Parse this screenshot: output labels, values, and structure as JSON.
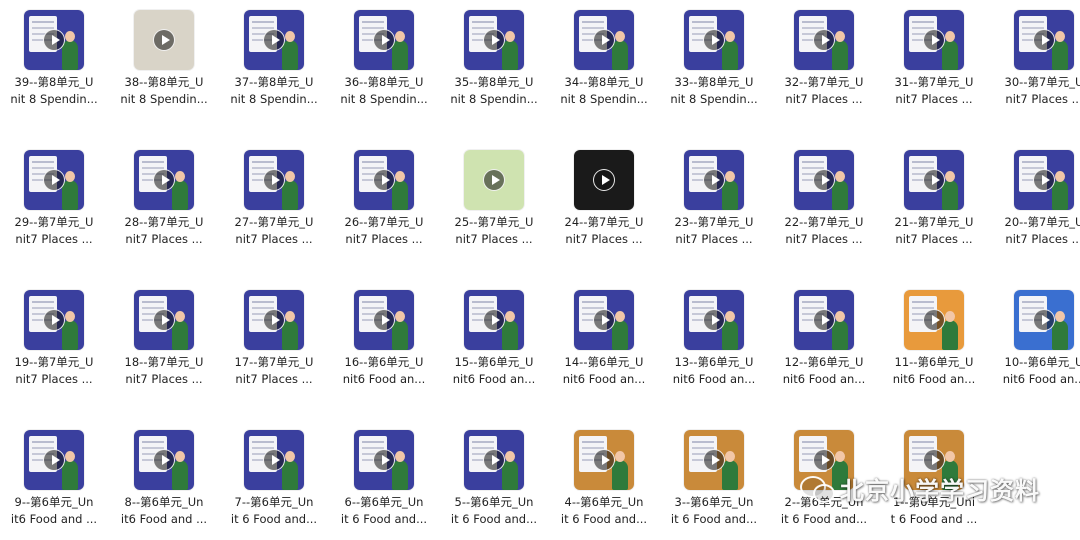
{
  "videos": [
    {
      "line1": "39--第8单元_U",
      "line2": "nit 8 Spendin...",
      "bg": "#3a3f9e"
    },
    {
      "line1": "38--第8单元_U",
      "line2": "nit 8 Spendin...",
      "bg": "#d9d4c8"
    },
    {
      "line1": "37--第8单元_U",
      "line2": "nit 8 Spendin...",
      "bg": "#3a3f9e"
    },
    {
      "line1": "36--第8单元_U",
      "line2": "nit 8 Spendin...",
      "bg": "#3a3f9e"
    },
    {
      "line1": "35--第8单元_U",
      "line2": "nit 8 Spendin...",
      "bg": "#3a3f9e"
    },
    {
      "line1": "34--第8单元_U",
      "line2": "nit 8 Spendin...",
      "bg": "#3a3f9e"
    },
    {
      "line1": "33--第8单元_U",
      "line2": "nit 8 Spendin...",
      "bg": "#3a3f9e"
    },
    {
      "line1": "32--第7单元_U",
      "line2": "nit7 Places ...",
      "bg": "#3a3f9e"
    },
    {
      "line1": "31--第7单元_U",
      "line2": "nit7 Places ...",
      "bg": "#3a3f9e"
    },
    {
      "line1": "30--第7单元_U",
      "line2": "nit7 Places ...",
      "bg": "#3a3f9e"
    },
    {
      "line1": "29--第7单元_U",
      "line2": "nit7 Places ...",
      "bg": "#3a3f9e"
    },
    {
      "line1": "28--第7单元_U",
      "line2": "nit7 Places ...",
      "bg": "#3a3f9e"
    },
    {
      "line1": "27--第7单元_U",
      "line2": "nit7 Places ...",
      "bg": "#3a3f9e"
    },
    {
      "line1": "26--第7单元_U",
      "line2": "nit7 Places ...",
      "bg": "#3a3f9e"
    },
    {
      "line1": "25--第7单元_U",
      "line2": "nit7 Places ...",
      "bg": "#cfe3b0"
    },
    {
      "line1": "24--第7单元_U",
      "line2": "nit7 Places ...",
      "bg": "#1a1a1a"
    },
    {
      "line1": "23--第7单元_U",
      "line2": "nit7 Places ...",
      "bg": "#3a3f9e"
    },
    {
      "line1": "22--第7单元_U",
      "line2": "nit7 Places ...",
      "bg": "#3a3f9e"
    },
    {
      "line1": "21--第7单元_U",
      "line2": "nit7 Places ...",
      "bg": "#3a3f9e"
    },
    {
      "line1": "20--第7单元_U",
      "line2": "nit7 Places ...",
      "bg": "#3a3f9e"
    },
    {
      "line1": "19--第7单元_U",
      "line2": "nit7 Places ...",
      "bg": "#3a3f9e"
    },
    {
      "line1": "18--第7单元_U",
      "line2": "nit7 Places ...",
      "bg": "#3a3f9e"
    },
    {
      "line1": "17--第7单元_U",
      "line2": "nit7 Places ...",
      "bg": "#3a3f9e"
    },
    {
      "line1": "16--第6单元_U",
      "line2": "nit6 Food an...",
      "bg": "#3a3f9e"
    },
    {
      "line1": "15--第6单元_U",
      "line2": "nit6 Food an...",
      "bg": "#3a3f9e"
    },
    {
      "line1": "14--第6单元_U",
      "line2": "nit6 Food an...",
      "bg": "#3a3f9e"
    },
    {
      "line1": "13--第6单元_U",
      "line2": "nit6 Food an...",
      "bg": "#3a3f9e"
    },
    {
      "line1": "12--第6单元_U",
      "line2": "nit6 Food an...",
      "bg": "#3a3f9e"
    },
    {
      "line1": "11--第6单元_U",
      "line2": "nit6 Food an...",
      "bg": "#e89a3c"
    },
    {
      "line1": "10--第6单元_U",
      "line2": "nit6 Food an...",
      "bg": "#3a6fd0"
    },
    {
      "line1": "9--第6单元_Un",
      "line2": "it6 Food and ...",
      "bg": "#3a3f9e"
    },
    {
      "line1": "8--第6单元_Un",
      "line2": "it6 Food and ...",
      "bg": "#3a3f9e"
    },
    {
      "line1": "7--第6单元_Un",
      "line2": "it 6 Food and...",
      "bg": "#3a3f9e"
    },
    {
      "line1": "6--第6单元_Un",
      "line2": "it 6 Food and...",
      "bg": "#3a3f9e"
    },
    {
      "line1": "5--第6单元_Un",
      "line2": "it 6 Food and...",
      "bg": "#3a3f9e"
    },
    {
      "line1": "4--第6单元_Un",
      "line2": "it 6 Food and...",
      "bg": "#c98a3a"
    },
    {
      "line1": "3--第6单元_Un",
      "line2": "it 6 Food and...",
      "bg": "#c98a3a"
    },
    {
      "line1": "2--第6单元_Un",
      "line2": "it 6 Food and...",
      "bg": "#c98a3a"
    },
    {
      "line1": "1--第6单元_Uni",
      "line2": "t 6 Food and ...",
      "bg": "#c98a3a"
    }
  ],
  "watermark": {
    "text": "北京小学学习资料",
    "icon": "wechat-icon"
  }
}
